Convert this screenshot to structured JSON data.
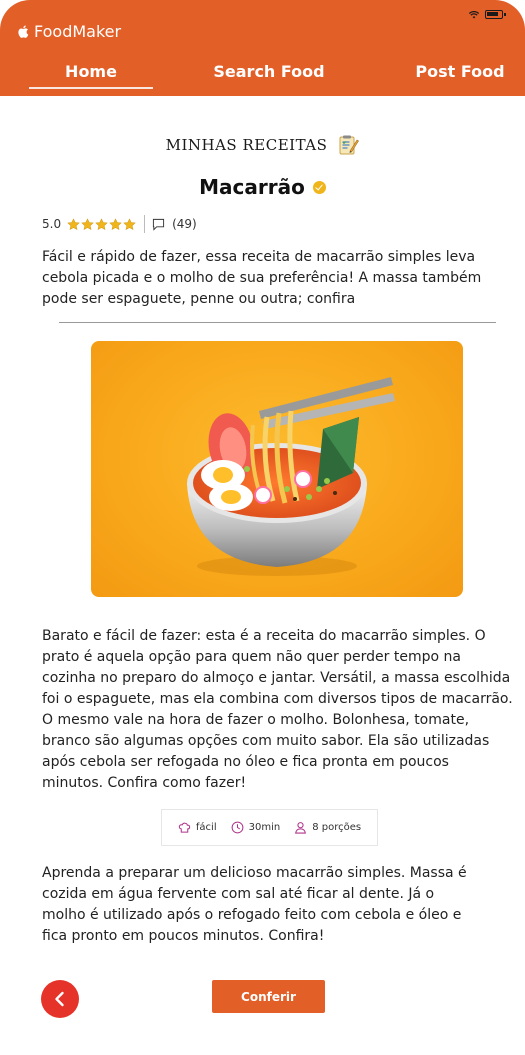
{
  "app": {
    "name": "FoodMaker"
  },
  "nav": {
    "tabs": [
      {
        "label": "Home",
        "active": true
      },
      {
        "label": "Search Food",
        "active": false
      },
      {
        "label": "Post Food",
        "active": false
      }
    ]
  },
  "colors": {
    "brand": "#e35f28",
    "star": "#f1b51c",
    "back_button": "#e63329",
    "chip_icon": "#b0338a"
  },
  "section": {
    "title": "MINHAS RECEITAS",
    "icon": "notepad-icon"
  },
  "recipe": {
    "title": "Macarrão",
    "verified": true,
    "rating": {
      "value": "5.0",
      "stars": 5,
      "max_stars": 5
    },
    "comments_count": "(49)",
    "intro": "Fácil e rápido de fazer, essa receita de macarrão simples leva cebola picada e o molho de sua preferência! A massa também pode ser espaguete, penne ou outra; confira",
    "image": "ramen-bowl-illustration",
    "description": "Barato e fácil de fazer: esta é a receita do macarrão simples. O prato é aquela opção para quem não quer perder tempo na cozinha no preparo do almoço e jantar. Versátil, a massa escolhida foi o espaguete, mas ela combina com diversos tipos de macarrão. O mesmo vale na hora de fazer o molho. Bolonhesa, tomate, branco são algumas opções com muito sabor. Ela são utilizadas após cebola ser refogada no óleo e fica pronta em poucos minutos. Confira como fazer!",
    "info": {
      "difficulty": "fácil",
      "time": "30min",
      "servings": "8 porções"
    },
    "closing": "Aprenda a preparar um delicioso macarrão simples. Massa é cozida em água fervente com sal até ficar al dente. Já o molho é utilizado após o refogado feito com cebola e óleo e fica pronto em poucos minutos. Confira!"
  },
  "actions": {
    "confirm_label": "Conferir"
  }
}
